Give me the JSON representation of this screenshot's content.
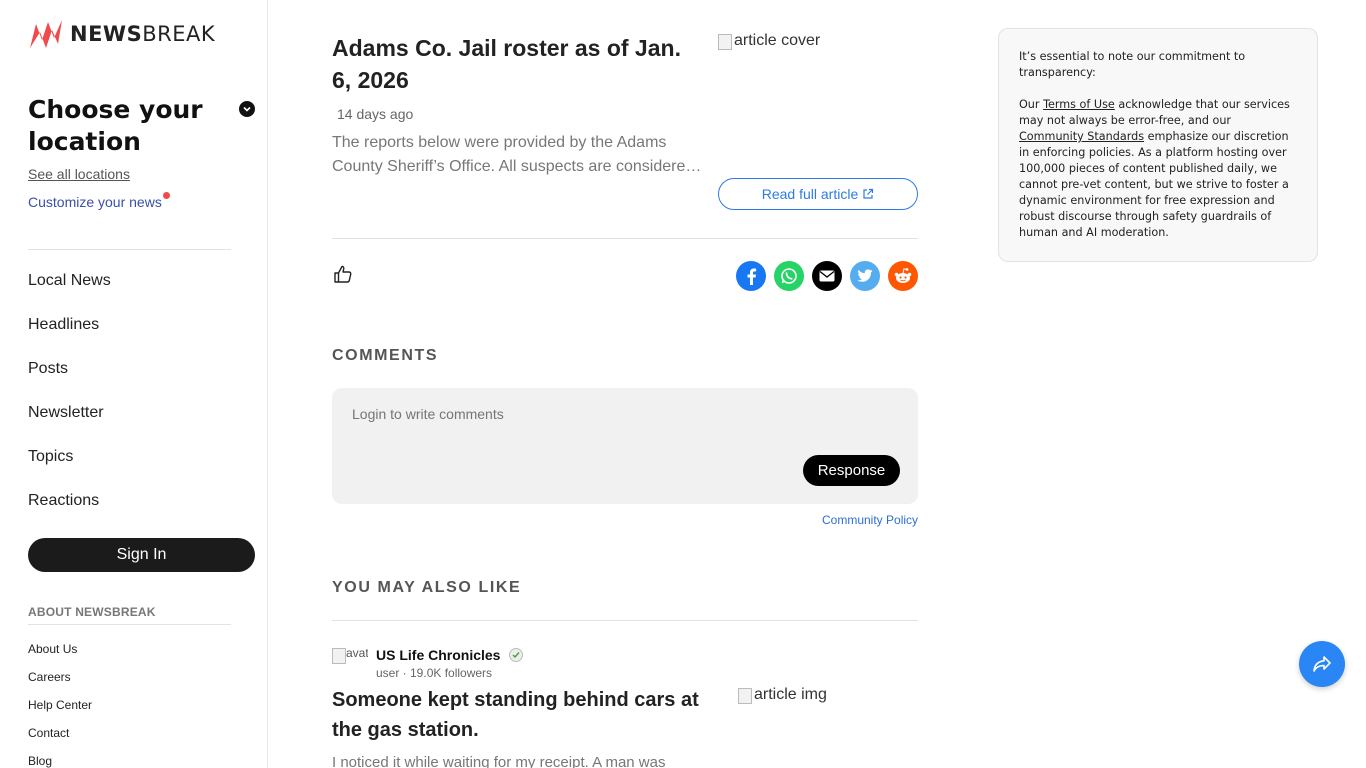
{
  "brand": {
    "name_bold": "NEWS",
    "name_rest": "BREAK",
    "color": "#ef4b4b"
  },
  "sidebar": {
    "location_title": "Choose your location",
    "see_all": "See all locations",
    "customize": "Customize your news",
    "nav": [
      {
        "label": "Local News"
      },
      {
        "label": "Headlines"
      },
      {
        "label": "Posts"
      },
      {
        "label": "Newsletter"
      },
      {
        "label": "Topics"
      },
      {
        "label": "Reactions"
      }
    ],
    "sign_in": "Sign In",
    "about_heading": "ABOUT NEWSBREAK",
    "about_links": [
      {
        "label": "About Us"
      },
      {
        "label": "Careers"
      },
      {
        "label": "Help Center"
      },
      {
        "label": "Contact"
      },
      {
        "label": "Blog"
      }
    ]
  },
  "article": {
    "title": "Adams Co. Jail roster as of Jan. 6, 2026",
    "cover_alt": "article cover",
    "time": "14 days ago",
    "summary": "The reports below were provided by the Adams County Sheriff’s Office. All suspects are considered innocent until proven guilty.",
    "read_full": "Read full article"
  },
  "share_icons": [
    "facebook-icon",
    "whatsapp-icon",
    "email-icon",
    "twitter-icon",
    "reddit-icon"
  ],
  "colors": {
    "facebook": "#1877f2",
    "whatsapp": "#25d366",
    "email": "#000000",
    "twitter": "#55acee",
    "reddit": "#ff5700",
    "accent": "#2c7be5"
  },
  "comments": {
    "heading": "COMMENTS",
    "placeholder": "Login to write comments",
    "response": "Response",
    "policy": "Community Policy"
  },
  "recommend": {
    "heading": "YOU MAY ALSO LIKE",
    "avatar_alt": "avatar",
    "author": "US Life Chronicles",
    "meta": "user · 19.0K followers",
    "title": "Someone kept standing behind cars at the gas station.",
    "img_alt": "article img",
    "snippet": "I noticed it while waiting for my receipt. A man was"
  },
  "notice": {
    "intro": "It’s essential to note our commitment to transparency:",
    "p_before_terms": "Our ",
    "terms": "Terms of Use",
    "p_mid": " acknowledge that our services may not always be error-free, and our ",
    "standards": "Community Standards",
    "p_after": " emphasize our discretion in enforcing policies. As a platform hosting over 100,000 pieces of content published daily, we cannot pre-vet content, but we strive to foster a dynamic environment for free expression and robust discourse through safety guardrails of human and AI moderation."
  }
}
